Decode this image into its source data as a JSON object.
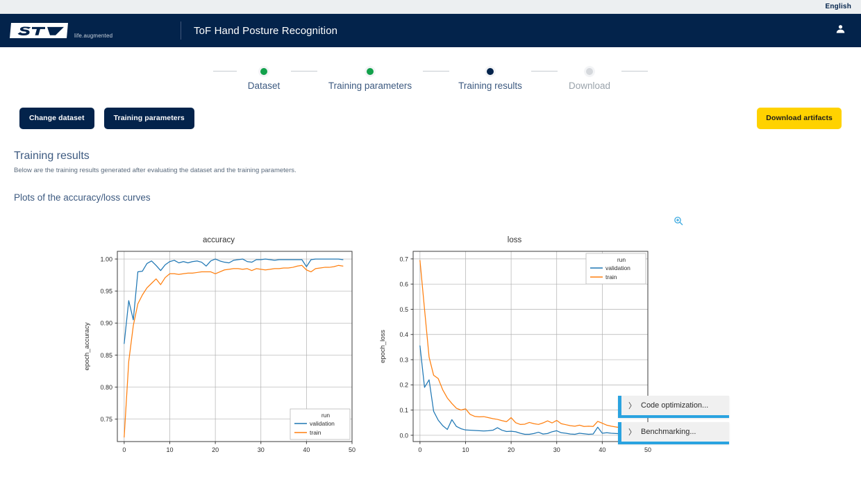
{
  "topbar": {
    "language": "English"
  },
  "header": {
    "brand_name": "ST",
    "tagline": "life.augmented",
    "title": "ToF Hand Posture Recognition",
    "user_icon": "user-icon"
  },
  "stepper": {
    "steps": [
      {
        "label": "Dataset",
        "state": "done"
      },
      {
        "label": "Training parameters",
        "state": "done"
      },
      {
        "label": "Training results",
        "state": "current"
      },
      {
        "label": "Download",
        "state": "pending"
      }
    ]
  },
  "toolbar": {
    "change_dataset_label": "Change dataset",
    "training_parameters_label": "Training parameters",
    "download_artifacts_label": "Download artifacts"
  },
  "main": {
    "section_title": "Training results",
    "section_subtitle": "Below are the training results generated after evaluating the dataset and the training parameters.",
    "plots_title": "Plots of the accuracy/loss curves",
    "zoom_icon": "zoom-in-icon"
  },
  "overlay_panels": [
    {
      "label": "Code optimization...",
      "chevron": "〉"
    },
    {
      "label": "Benchmarking...",
      "chevron": "〉"
    }
  ],
  "colors": {
    "brand_navy": "#03234b",
    "accent_yellow": "#ffd200",
    "step_done": "#12a14b",
    "step_pending": "#d5d8dc",
    "panel_blue": "#2aa3e0",
    "series_validation": "#1f77b4",
    "series_train": "#ff7f0e"
  },
  "chart_data": [
    {
      "type": "line",
      "title": "accuracy",
      "xlabel": "",
      "ylabel": "epoch_accuracy",
      "xlim": [
        -1.5,
        50
      ],
      "ylim": [
        0.715,
        1.012
      ],
      "xticks": [
        0,
        10,
        20,
        30,
        40,
        50
      ],
      "yticks": [
        0.75,
        0.8,
        0.85,
        0.9,
        0.95,
        1.0
      ],
      "ytick_labels": [
        "0.75",
        "0.80",
        "0.85",
        "0.90",
        "0.95",
        "1.00"
      ],
      "grid": true,
      "legend": {
        "title": "run",
        "position": "lower right",
        "entries": [
          "validation",
          "train"
        ]
      },
      "x": [
        0,
        1,
        2,
        3,
        4,
        5,
        6,
        7,
        8,
        9,
        10,
        11,
        12,
        13,
        14,
        15,
        16,
        17,
        18,
        19,
        20,
        21,
        22,
        23,
        24,
        25,
        26,
        27,
        28,
        29,
        30,
        31,
        32,
        33,
        34,
        35,
        36,
        37,
        38,
        39,
        40,
        41,
        42,
        43,
        44,
        45,
        46,
        47,
        48
      ],
      "series": [
        {
          "name": "validation",
          "color": "#1f77b4",
          "values": [
            0.868,
            0.935,
            0.905,
            0.98,
            0.981,
            0.993,
            0.997,
            0.99,
            0.982,
            0.991,
            0.996,
            0.998,
            0.994,
            0.996,
            0.994,
            0.996,
            0.997,
            0.995,
            0.989,
            0.997,
            1.0,
            0.997,
            0.995,
            0.994,
            0.998,
            0.999,
            1.0,
            0.996,
            0.995,
            0.999,
            0.999,
            1.0,
            0.999,
            0.998,
            0.999,
            0.999,
            0.999,
            0.999,
            0.999,
            0.999,
            0.988,
            0.999,
            1.0,
            1.0,
            1.0,
            1.0,
            1.0,
            1.0,
            0.999
          ]
        },
        {
          "name": "train",
          "color": "#ff7f0e",
          "values": [
            0.722,
            0.84,
            0.896,
            0.93,
            0.944,
            0.955,
            0.962,
            0.969,
            0.96,
            0.971,
            0.977,
            0.977,
            0.976,
            0.977,
            0.978,
            0.978,
            0.979,
            0.98,
            0.98,
            0.98,
            0.977,
            0.98,
            0.983,
            0.984,
            0.985,
            0.985,
            0.984,
            0.985,
            0.982,
            0.985,
            0.984,
            0.983,
            0.984,
            0.985,
            0.985,
            0.986,
            0.986,
            0.987,
            0.989,
            0.99,
            0.983,
            0.98,
            0.985,
            0.986,
            0.987,
            0.987,
            0.988,
            0.99,
            0.989
          ]
        }
      ]
    },
    {
      "type": "line",
      "title": "loss",
      "xlabel": "",
      "ylabel": "epoch_loss",
      "xlim": [
        -1.5,
        50
      ],
      "ylim": [
        -0.025,
        0.73
      ],
      "xticks": [
        0,
        10,
        20,
        30,
        40,
        50
      ],
      "yticks": [
        0.0,
        0.1,
        0.2,
        0.3,
        0.4,
        0.5,
        0.6,
        0.7
      ],
      "ytick_labels": [
        "0.0",
        "0.1",
        "0.2",
        "0.3",
        "0.4",
        "0.5",
        "0.6",
        "0.7"
      ],
      "grid": true,
      "legend": {
        "title": "run",
        "position": "upper right",
        "entries": [
          "validation",
          "train"
        ]
      },
      "x": [
        0,
        1,
        2,
        3,
        4,
        5,
        6,
        7,
        8,
        9,
        10,
        11,
        12,
        13,
        14,
        15,
        16,
        17,
        18,
        19,
        20,
        21,
        22,
        23,
        24,
        25,
        26,
        27,
        28,
        29,
        30,
        31,
        32,
        33,
        34,
        35,
        36,
        37,
        38,
        39,
        40,
        41,
        42,
        43,
        44,
        45,
        46,
        47,
        48
      ],
      "series": [
        {
          "name": "validation",
          "color": "#1f77b4",
          "values": [
            0.355,
            0.19,
            0.22,
            0.095,
            0.06,
            0.038,
            0.023,
            0.062,
            0.035,
            0.026,
            0.021,
            0.02,
            0.019,
            0.018,
            0.017,
            0.018,
            0.02,
            0.03,
            0.02,
            0.015,
            0.016,
            0.014,
            0.008,
            0.004,
            0.004,
            0.007,
            0.012,
            0.005,
            0.007,
            0.014,
            0.018,
            0.01,
            0.008,
            0.005,
            0.004,
            0.008,
            0.006,
            0.004,
            0.005,
            0.032,
            0.008,
            0.01,
            0.008,
            0.007,
            0.006,
            0.006,
            0.005,
            0.005,
            0.006
          ]
        },
        {
          "name": "train",
          "color": "#ff7f0e",
          "values": [
            0.694,
            0.5,
            0.31,
            0.238,
            0.225,
            0.18,
            0.148,
            0.126,
            0.107,
            0.1,
            0.105,
            0.083,
            0.075,
            0.073,
            0.074,
            0.07,
            0.066,
            0.063,
            0.058,
            0.054,
            0.07,
            0.05,
            0.043,
            0.044,
            0.051,
            0.046,
            0.043,
            0.049,
            0.057,
            0.049,
            0.059,
            0.046,
            0.042,
            0.038,
            0.036,
            0.04,
            0.035,
            0.036,
            0.035,
            0.055,
            0.048,
            0.04,
            0.036,
            0.033,
            0.03,
            0.03,
            0.034,
            0.036,
            0.033
          ]
        }
      ]
    }
  ]
}
